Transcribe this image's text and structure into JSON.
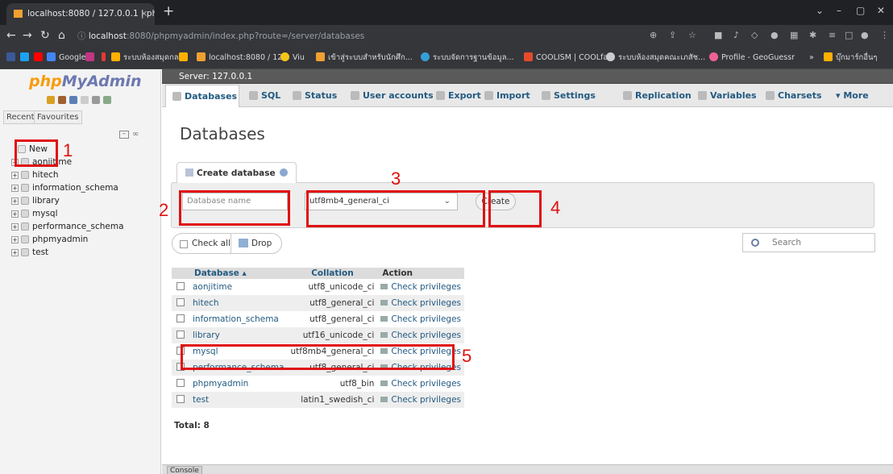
{
  "browser": {
    "tab_title": "localhost:8080 / 127.0.0.1 | php",
    "tab_close": "×",
    "new_tab": "+",
    "url_host": "localhost",
    "url_rest": ":8080/phpmyadmin/index.php?route=/server/databases",
    "window_controls": [
      "⌄",
      "–",
      "▢",
      "✕"
    ],
    "bookmarks": [
      {
        "label": "Google",
        "color": "#4285f4"
      },
      {
        "label": "ระบบห้องสมุดกลาง",
        "color": "#ffb000"
      },
      {
        "label": "localhost:8080 / 12...",
        "color": "#f0a030"
      },
      {
        "label": "Viu",
        "color": "#f5c518"
      },
      {
        "label": "เข้าสู่ระบบสำหรับนักศึก...",
        "color": "#f0a030"
      },
      {
        "label": "ระบบจัดการฐานข้อมูล...",
        "color": "#35a0d8"
      },
      {
        "label": "COOLISM | COOLfa...",
        "color": "#e44b2a"
      },
      {
        "label": "ระบบห้องสมุดคณะเภสัช...",
        "color": "#cccccc"
      },
      {
        "label": "Profile - GeoGuessr",
        "color": "#f06292"
      },
      {
        "label": "บุ๊กมาร์กอื่นๆ",
        "color": "#ffb000"
      }
    ]
  },
  "sidebar": {
    "logo_a": "php",
    "logo_b": "MyAdmin",
    "tab_recent": "Recent",
    "tab_favourites": "Favourites",
    "collapse": "–",
    "link": "∞",
    "new_label": "New",
    "databases": [
      "aonjitime",
      "hitech",
      "information_schema",
      "library",
      "mysql",
      "performance_schema",
      "phpmyadmin",
      "test"
    ]
  },
  "main": {
    "server": "Server: 127.0.0.1",
    "tabs": [
      "Databases",
      "SQL",
      "Status",
      "User accounts",
      "Export",
      "Import",
      "Settings",
      "Replication",
      "Variables",
      "Charsets",
      "More"
    ],
    "heading": "Databases",
    "create_tab": "Create database",
    "db_name_placeholder": "Database name",
    "collation_value": "utf8mb4_general_ci",
    "create_button": "Create",
    "check_all": "Check all",
    "drop": "Drop",
    "search": "Search",
    "table": {
      "headers": [
        "Database",
        "Collation",
        "Action"
      ],
      "rows": [
        {
          "name": "aonjitime",
          "collation": "utf8_unicode_ci",
          "action": "Check privileges"
        },
        {
          "name": "hitech",
          "collation": "utf8_general_ci",
          "action": "Check privileges"
        },
        {
          "name": "information_schema",
          "collation": "utf8_general_ci",
          "action": "Check privileges"
        },
        {
          "name": "library",
          "collation": "utf16_unicode_ci",
          "action": "Check privileges"
        },
        {
          "name": "mysql",
          "collation": "utf8mb4_general_ci",
          "action": "Check privileges"
        },
        {
          "name": "performance_schema",
          "collation": "utf8_general_ci",
          "action": "Check privileges"
        },
        {
          "name": "phpmyadmin",
          "collation": "utf8_bin",
          "action": "Check privileges"
        },
        {
          "name": "test",
          "collation": "latin1_swedish_ci",
          "action": "Check privileges"
        }
      ]
    },
    "total": "Total: 8",
    "console": "Console"
  },
  "annotations": [
    "1",
    "2",
    "3",
    "4",
    "5"
  ],
  "annotation_color": "#e01010"
}
